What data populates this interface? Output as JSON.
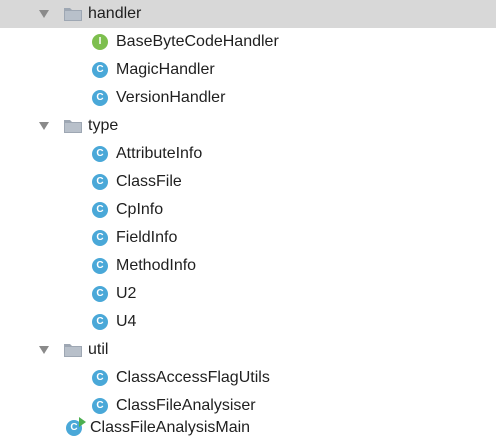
{
  "tree": {
    "handler": {
      "label": "handler",
      "children": [
        "BaseByteCodeHandler",
        "MagicHandler",
        "VersionHandler"
      ]
    },
    "type": {
      "label": "type",
      "children": [
        "AttributeInfo",
        "ClassFile",
        "CpInfo",
        "FieldInfo",
        "MethodInfo",
        "U2",
        "U4"
      ]
    },
    "util": {
      "label": "util",
      "children": [
        "ClassAccessFlagUtils",
        "ClassFileAnalysiser"
      ]
    },
    "main": "ClassFileAnalysisMain"
  },
  "icons": {
    "class_letter": "C",
    "interface_letter": "I"
  }
}
